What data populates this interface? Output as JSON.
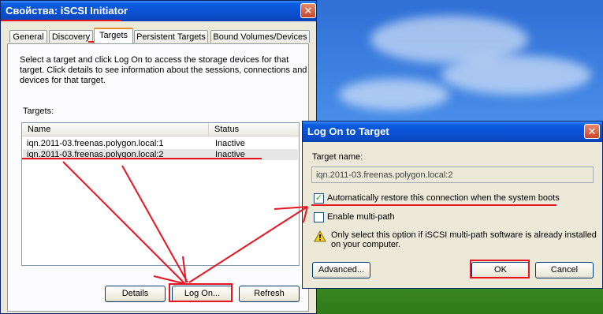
{
  "main_window": {
    "title": "Свойства: iSCSI Initiator",
    "close_glyph": "✕",
    "tabs": [
      "General",
      "Discovery",
      "Targets",
      "Persistent Targets",
      "Bound Volumes/Devices"
    ],
    "active_tab": "Targets",
    "description_lines": [
      "Select a target and click Log On to access the storage devices for that",
      "target. Click details to see information about the sessions, connections and",
      "devices for that target."
    ],
    "targets_label": "Targets:",
    "columns": [
      "Name",
      "Status"
    ],
    "rows": [
      {
        "name": "iqn.2011-03.freenas.polygon.local:1",
        "status": "Inactive"
      },
      {
        "name": "iqn.2011-03.freenas.polygon.local:2",
        "status": "Inactive"
      }
    ],
    "buttons": {
      "details": "Details",
      "log_on": "Log On...",
      "refresh": "Refresh"
    }
  },
  "dialog": {
    "title": "Log On to Target",
    "close_glyph": "✕",
    "target_name_label": "Target name:",
    "target_name_value": "iqn.2011-03.freenas.polygon.local:2",
    "restore_checkbox": {
      "label": "Automatically restore this connection when the system boots",
      "checked": true
    },
    "multipath_checkbox": {
      "label": "Enable multi-path",
      "checked": false
    },
    "warning_lines": [
      "Only select this option if iSCSI multi-path software is already installed",
      "on your computer."
    ],
    "warning_icon": "warning-icon",
    "buttons": {
      "advanced": "Advanced...",
      "ok": "OK",
      "cancel": "Cancel"
    }
  },
  "annotation_color": "#e8141e"
}
